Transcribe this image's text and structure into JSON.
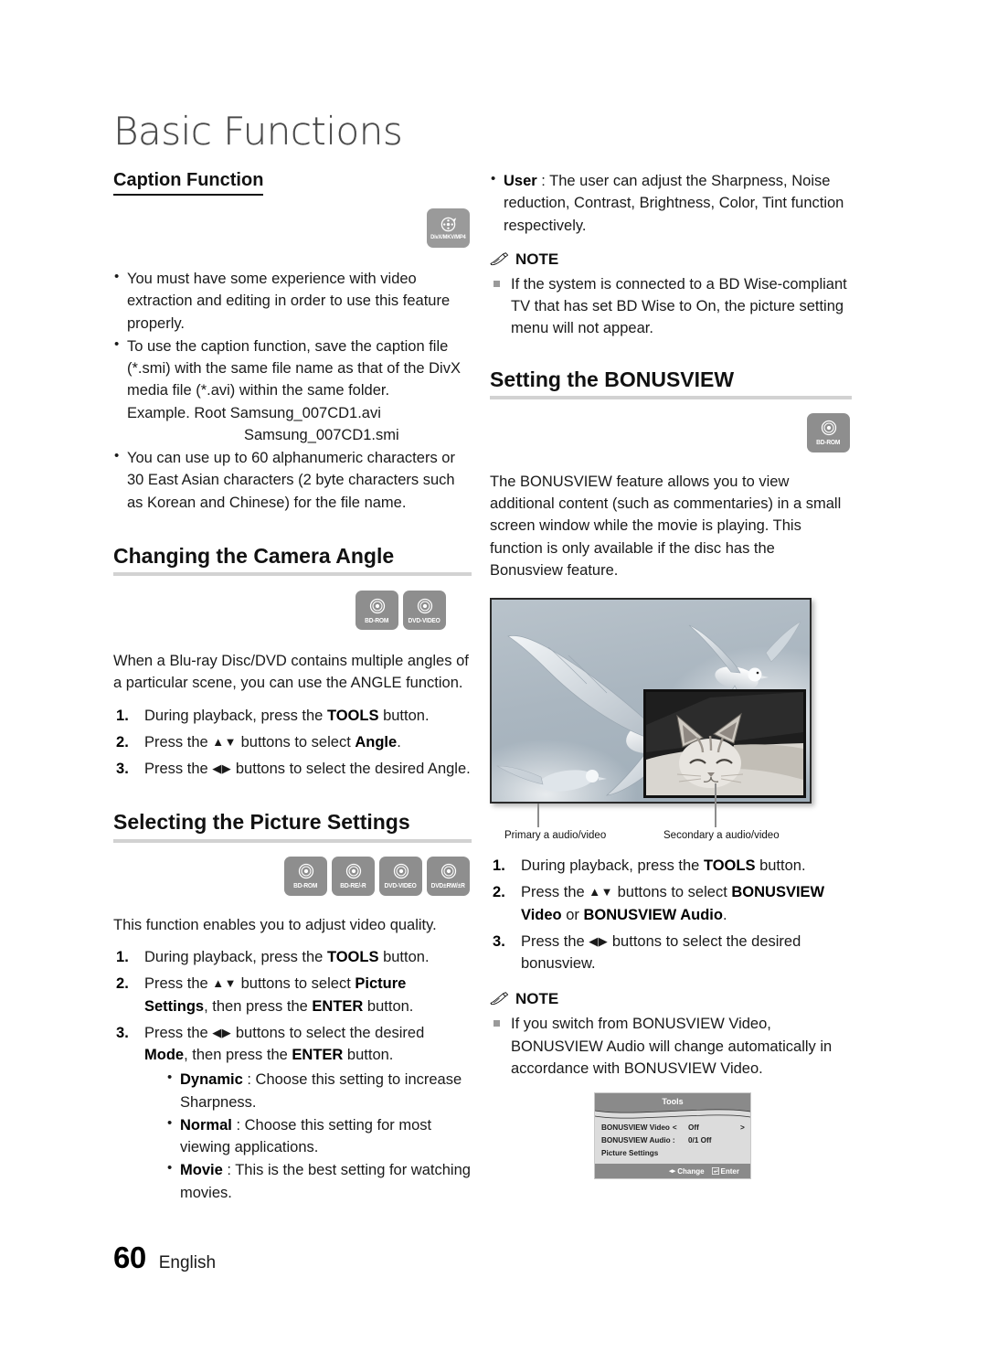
{
  "chapter": {
    "title": "Basic Functions"
  },
  "footer": {
    "page_number": "60",
    "language": "English"
  },
  "left_column": {
    "caption_function": {
      "heading": "Caption Function",
      "badge": {
        "label": "DivX/MKV/MP4",
        "icon": "film-reel-icon"
      },
      "bullets": [
        "You must have some experience with video extraction and editing in order to use this feature properly.",
        "To use the caption function, save the caption file (*.smi) with the same file name as that of the DivX media file (*.avi) within the same folder.",
        "You can use up to 60 alphanumeric characters or 30 East Asian characters (2 byte characters such as Korean and Chinese) for the file name."
      ],
      "example_line1": "Example. Root Samsung_007CD1.avi",
      "example_line2": "Samsung_007CD1.smi"
    },
    "camera_angle": {
      "heading": "Changing the Camera Angle",
      "badges": [
        "BD-ROM",
        "DVD-VIDEO"
      ],
      "intro": "When a Blu-ray Disc/DVD contains multiple angles of a particular scene, you can use the ANGLE function.",
      "steps": [
        {
          "pre": "During playback, press the ",
          "bold": "TOOLS",
          "post": " button."
        },
        {
          "pre": "Press the ",
          "arrows": "▲▼",
          "mid": " buttons to select ",
          "bold": "Angle",
          "post": "."
        },
        {
          "pre": "Press the ",
          "arrows": "◀▶",
          "mid": " buttons to select the desired Angle.",
          "bold": "",
          "post": ""
        }
      ]
    },
    "picture_settings": {
      "heading": "Selecting the Picture Settings",
      "badges": [
        "BD-ROM",
        "BD-RE/-R",
        "DVD-VIDEO",
        "DVD±RW/±R"
      ],
      "intro": "This function enables you to adjust video quality.",
      "step1": {
        "pre": "During playback, press the ",
        "bold": "TOOLS",
        "post": " button."
      },
      "step2": {
        "pre": "Press the ",
        "arrows": "▲▼",
        "mid": " buttons to select ",
        "bold1": "Picture Settings",
        "mid2": ", then press the ",
        "bold2": "ENTER",
        "post": " button."
      },
      "step3": {
        "pre": "Press the ",
        "arrows": "◀▶",
        "mid": " buttons to select the desired ",
        "bold1": "Mode",
        "mid2": ", then press the ",
        "bold2": "ENTER",
        "post": " button."
      },
      "modes": [
        {
          "name": "Dynamic",
          "desc": " : Choose this setting to increase Sharpness."
        },
        {
          "name": "Normal",
          "desc": " : Choose this setting for most viewing applications."
        },
        {
          "name": "Movie",
          "desc": " : This is the best setting for watching movies."
        }
      ]
    }
  },
  "right_column": {
    "user_mode": {
      "name": "User",
      "desc": " : The user can adjust the Sharpness, Noise reduction, Contrast, Brightness, Color, Tint function respectively."
    },
    "note1": {
      "label": "NOTE",
      "icon": "pencil-icon",
      "items": [
        "If the system is connected to a BD Wise-compliant TV that has set BD Wise to On, the picture setting menu will not appear."
      ]
    },
    "bonusview": {
      "heading": "Setting the BONUSVIEW",
      "badges": [
        "BD-ROM"
      ],
      "intro": "The BONUSVIEW feature allows you to view additional content (such as commentaries) in a small screen window while the movie is playing. This function is only available if the disc has the Bonusview feature.",
      "figure": {
        "primary_label": "Primary a audio/video",
        "secondary_label": "Secondary a audio/video"
      },
      "steps": [
        {
          "pre": "During playback, press the ",
          "bold": "TOOLS",
          "post": " button."
        },
        {
          "pre": "Press the ",
          "arrows": "▲▼",
          "mid": " buttons to select ",
          "bold1": "BONUSVIEW Video",
          "mid2": " or ",
          "bold2": "BONUSVIEW Audio",
          "post": "."
        },
        {
          "pre": "Press the ",
          "arrows": "◀▶",
          "mid": " buttons to select the desired bonusview.",
          "post": ""
        }
      ]
    },
    "note2": {
      "label": "NOTE",
      "icon": "pencil-icon",
      "items": [
        "If you switch from BONUSVIEW Video, BONUSVIEW Audio will change automatically in accordance with BONUSVIEW Video."
      ]
    },
    "tools_osd": {
      "title": "Tools",
      "rows": [
        {
          "label": "BONUSVIEW Video",
          "left_arrow": "<",
          "value": "Off",
          "right_arrow": ">"
        },
        {
          "label": "BONUSVIEW Audio :",
          "value": "0/1 Off"
        },
        {
          "label": "Picture Settings",
          "value": ""
        }
      ],
      "footer_change": "Change",
      "footer_enter": "Enter",
      "footer_arrows": "◂▸"
    }
  }
}
